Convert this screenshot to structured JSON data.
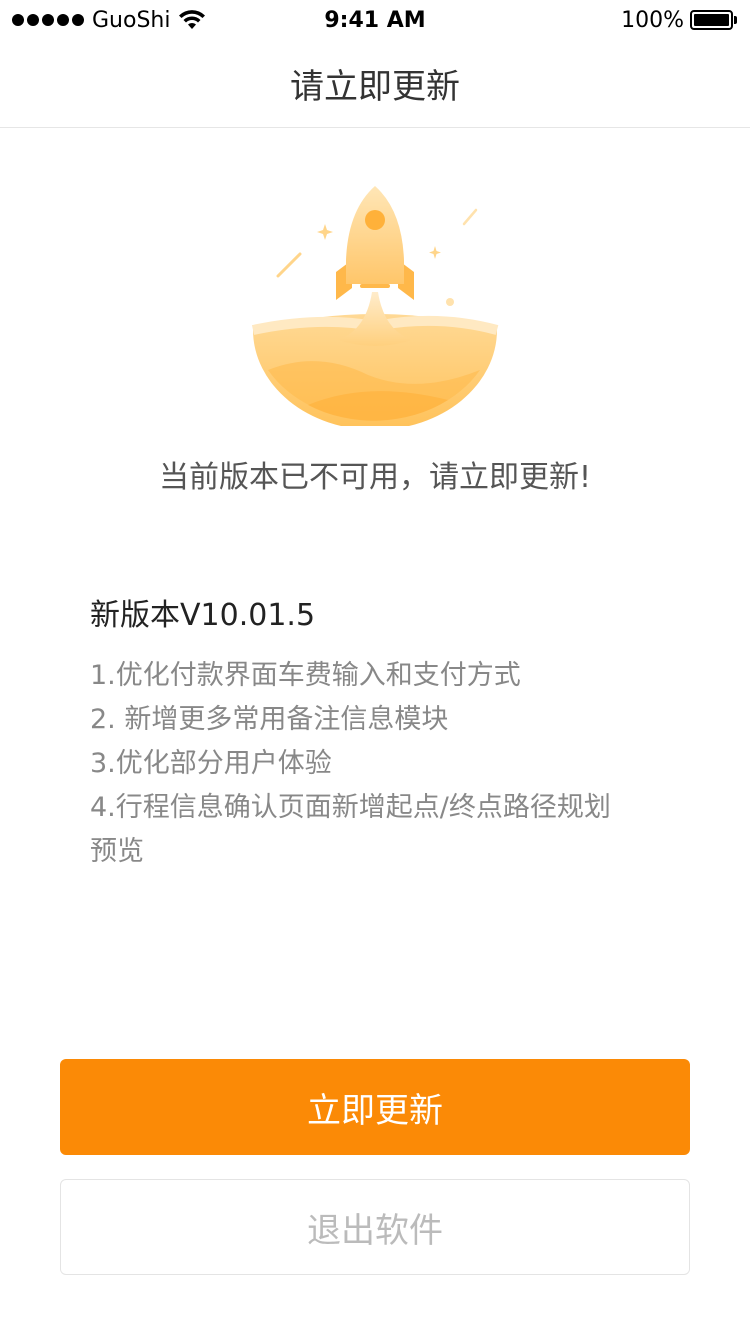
{
  "status_bar": {
    "carrier": "GuoShi",
    "time": "9:41 AM",
    "battery": "100%",
    "icons": [
      "signal-dots-icon",
      "wifi-icon",
      "battery-icon"
    ]
  },
  "nav": {
    "title": "请立即更新"
  },
  "illustration": {
    "icon": "rocket-launch-icon",
    "colors": {
      "light": "#ffe9c2",
      "mid": "#ffcb74",
      "deep": "#ffb13a"
    }
  },
  "notice": "当前版本已不可用，请立即更新!",
  "version": {
    "title": "新版本V10.01.5",
    "changelog": [
      "1.优化付款界面车费输入和支付方式",
      "2. 新增更多常用备注信息模块",
      "3.优化部分用户体验",
      "4.行程信息确认页面新增起点/终点路径规划",
      "预览"
    ]
  },
  "buttons": {
    "update": "立即更新",
    "exit": "退出软件"
  },
  "colors": {
    "accent": "#fb8a06",
    "text_primary": "#333333",
    "text_secondary": "#888888",
    "border": "#e4e4e4"
  }
}
